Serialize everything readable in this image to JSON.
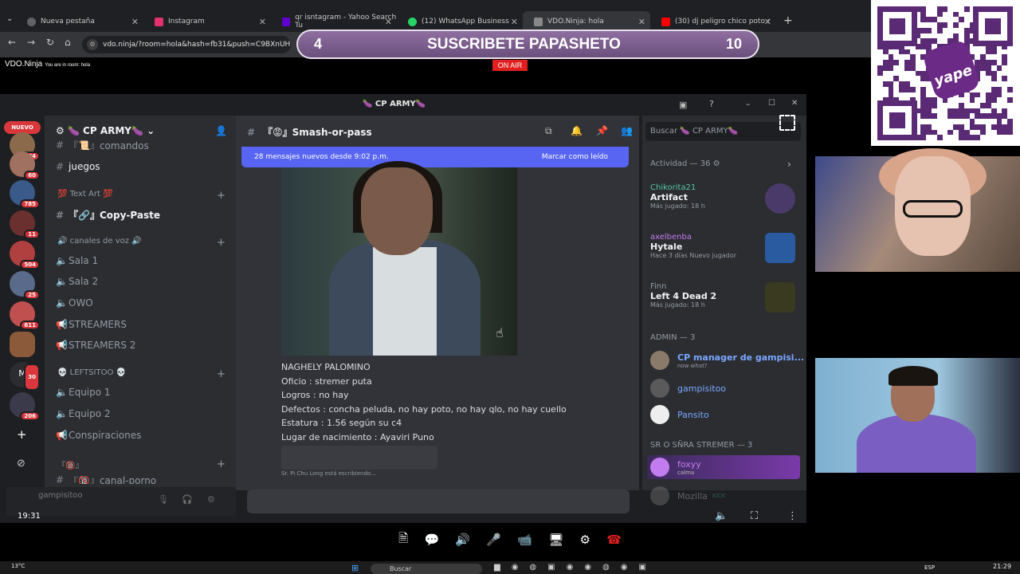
{
  "browser": {
    "tabs": [
      {
        "label": "Nueva pestaña",
        "icon": "chrome-icon",
        "color": "#5f6368"
      },
      {
        "label": "Instagram",
        "icon": "instagram-icon",
        "color": "#e1306c"
      },
      {
        "label": "qr isntagram - Yahoo Search Tu",
        "icon": "yahoo-icon",
        "color": "#6001d2"
      },
      {
        "label": "(12) WhatsApp Business",
        "icon": "whatsapp-icon",
        "color": "#25d366"
      },
      {
        "label": "VDO.Ninja: hola",
        "icon": "vdo-icon",
        "color": "#888888"
      },
      {
        "label": "(30) dj peligro chico poto r",
        "icon": "youtube-icon",
        "color": "#ff0000"
      }
    ],
    "url": "vdo.ninja/?room=hola&hash=fb31&push=C9BXnUH"
  },
  "overlay": {
    "banner_left": "4",
    "banner_text": "SUSCRIBETE PAPASHETO",
    "banner_right": "10",
    "on_air": "ON AIR",
    "vdo_brand": "VDO.Ninja",
    "vdo_room": "You are in room: hola",
    "clock_left": "19:31"
  },
  "discord": {
    "window_title": "🍆 CP ARMY🍆",
    "guild_name": "🍆 CP ARMY🍆",
    "nuevo_badge": "NUEVO",
    "server_badges": [
      "584",
      "60",
      "785",
      "11",
      "504",
      "25",
      "611",
      "30",
      "206"
    ],
    "channels": [
      {
        "type": "text",
        "label": "『📜』comandos"
      },
      {
        "type": "text",
        "label": "juegos",
        "active": true
      },
      {
        "type": "category",
        "label": "💯 Text Art 💯"
      },
      {
        "type": "text",
        "label": "『🔗』Copy-Paste",
        "active": true
      },
      {
        "type": "category",
        "label": "🔊 canales de voz 🔊"
      },
      {
        "type": "voice",
        "label": "Sala 1"
      },
      {
        "type": "voice",
        "label": "Sala 2"
      },
      {
        "type": "voice",
        "label": "OWO"
      },
      {
        "type": "voice",
        "label": "STREAMERS"
      },
      {
        "type": "voice",
        "label": "STREAMERS 2"
      },
      {
        "type": "category",
        "label": "💀 LEFTSITOO 💀"
      },
      {
        "type": "voice",
        "label": "Equipo 1"
      },
      {
        "type": "voice",
        "label": "Equipo 2"
      },
      {
        "type": "voice",
        "label": "Conspiraciones"
      },
      {
        "type": "category",
        "label": "『🔞』"
      },
      {
        "type": "text",
        "label": "『🔞』canal-porno"
      }
    ],
    "user_panel": "gampisitoo",
    "chat_channel": "『😡』Smash-or-pass",
    "new_messages": "28 mensajes nuevos desde 9:02 p.m.",
    "mark_read": "Marcar como leído",
    "message_lines": [
      "NAGHELY PALOMINO",
      "Oficio : stremer puta",
      "Logros : no hay",
      "Defectos : concha peluda, no hay poto, no hay qlo, no hay cuello",
      "Estatura : 1.56 según su c4",
      "Lugar de nacimiento : Ayaviri Puno"
    ],
    "typing": "Sr. Pi Chu Long está escribiendo...",
    "search_placeholder": "Buscar 🍆 CP ARMY🍆",
    "activity_header": "Actividad — 36",
    "activities": [
      {
        "user": "Chikorita21",
        "user_color": "#57c7a2",
        "game": "Artifact",
        "detail": "Más jugado: 18 h",
        "art_color": "#4a3a6a"
      },
      {
        "user": "axelbenba",
        "user_color": "#c27cf0",
        "game": "Hytale",
        "detail": "Hace 3 días  Nuevo jugador",
        "art_color": "#2a5aa0"
      },
      {
        "user": "Finn",
        "user_color": "#949ba4",
        "game": "Left 4 Dead 2",
        "detail": "Más jugado: 18 h",
        "art_color": "#3a3a20"
      }
    ],
    "admin_header": "ADMIN — 3",
    "admins": [
      {
        "name": "CP manager de gampisi...",
        "status": "now what?",
        "color": "#7aa7ff"
      },
      {
        "name": "gampisitoo",
        "status": "",
        "color": "#7aa7ff"
      },
      {
        "name": "Pansito",
        "status": "",
        "color": "#7aa7ff"
      }
    ],
    "stremer_header": "SR O SÑRA STREMER — 3",
    "stremers": [
      {
        "name": "foxyy",
        "status": "calma",
        "color": "#c27cf0"
      },
      {
        "name": "Mozilla",
        "status": "KICK",
        "color": "#949ba4"
      }
    ]
  },
  "taskbar": {
    "temp": "13°C",
    "search": "Buscar",
    "lang": "ESP",
    "clock": "21:29"
  },
  "qr_brand": "yape"
}
